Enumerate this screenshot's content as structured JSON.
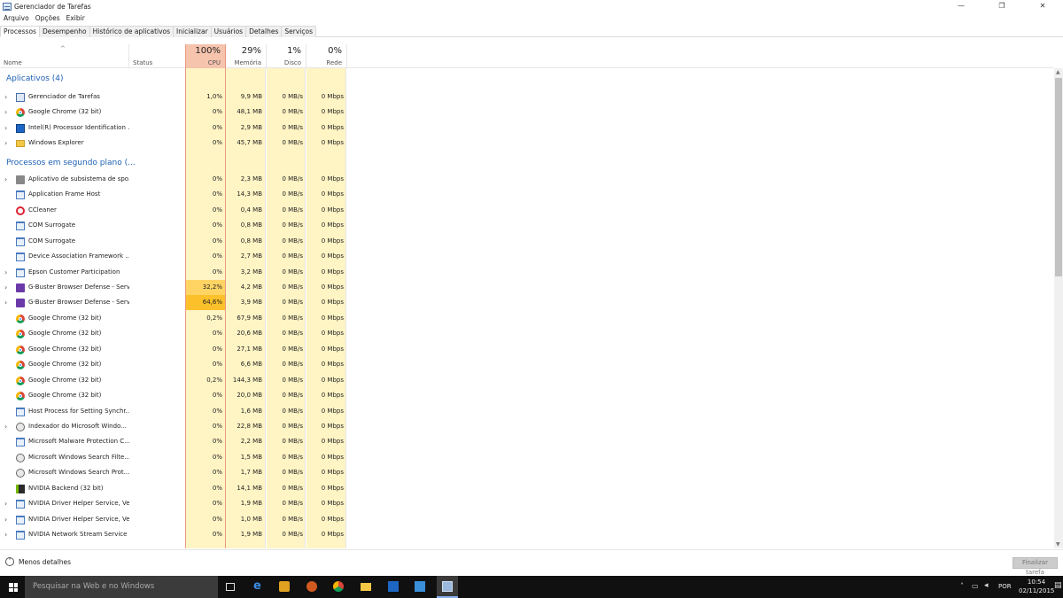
{
  "window": {
    "title": "Gerenciador de Tarefas",
    "minimize": "—",
    "restore": "❐",
    "close": "✕"
  },
  "menu": [
    "Arquivo",
    "Opções",
    "Exibir"
  ],
  "tabs": [
    "Processos",
    "Desempenho",
    "Histórico de aplicativos",
    "Inicializar",
    "Usuários",
    "Detalhes",
    "Serviços"
  ],
  "columns": {
    "name": "Nome",
    "status": "Status",
    "cpu": {
      "pct": "100%",
      "label": "CPU"
    },
    "mem": {
      "pct": "29%",
      "label": "Memória"
    },
    "disk": {
      "pct": "1%",
      "label": "Disco"
    },
    "net": {
      "pct": "0%",
      "label": "Rede"
    }
  },
  "groups": {
    "apps": "Aplicativos (4)",
    "background": "Processos em segundo plano (..."
  },
  "apps": [
    {
      "name": "Gerenciador de Tarefas",
      "cpu": "1,0%",
      "mem": "9,9 MB",
      "disk": "0 MB/s",
      "net": "0 Mbps",
      "icon": "taskmgr-icon",
      "expand": true
    },
    {
      "name": "Google Chrome (32 bit)",
      "cpu": "0%",
      "mem": "48,1 MB",
      "disk": "0 MB/s",
      "net": "0 Mbps",
      "icon": "chrome-icon",
      "expand": true
    },
    {
      "name": "Intel(R) Processor Identification ...",
      "cpu": "0%",
      "mem": "2,9 MB",
      "disk": "0 MB/s",
      "net": "0 Mbps",
      "icon": "intel-icon",
      "expand": true
    },
    {
      "name": "Windows Explorer",
      "cpu": "0%",
      "mem": "45,7 MB",
      "disk": "0 MB/s",
      "net": "0 Mbps",
      "icon": "explorer-icon",
      "expand": true
    }
  ],
  "background": [
    {
      "name": "Aplicativo de subsistema de spo...",
      "cpu": "0%",
      "mem": "2,3 MB",
      "disk": "0 MB/s",
      "net": "0 Mbps",
      "icon": "printer-icon",
      "expand": true
    },
    {
      "name": "Application Frame Host",
      "cpu": "0%",
      "mem": "14,3 MB",
      "disk": "0 MB/s",
      "net": "0 Mbps",
      "icon": "window-icon",
      "expand": false
    },
    {
      "name": "CCleaner",
      "cpu": "0%",
      "mem": "0,4 MB",
      "disk": "0 MB/s",
      "net": "0 Mbps",
      "icon": "ccleaner-icon",
      "expand": false
    },
    {
      "name": "COM Surrogate",
      "cpu": "0%",
      "mem": "0,8 MB",
      "disk": "0 MB/s",
      "net": "0 Mbps",
      "icon": "window-icon",
      "expand": false
    },
    {
      "name": "COM Surrogate",
      "cpu": "0%",
      "mem": "0,8 MB",
      "disk": "0 MB/s",
      "net": "0 Mbps",
      "icon": "window-icon",
      "expand": false
    },
    {
      "name": "Device Association Framework ...",
      "cpu": "0%",
      "mem": "2,7 MB",
      "disk": "0 MB/s",
      "net": "0 Mbps",
      "icon": "window-icon",
      "expand": false
    },
    {
      "name": "Epson Customer Participation",
      "cpu": "0%",
      "mem": "3,2 MB",
      "disk": "0 MB/s",
      "net": "0 Mbps",
      "icon": "window-icon",
      "expand": true
    },
    {
      "name": "G-Buster Browser Defense - Serv...",
      "cpu": "32,2%",
      "mem": "4,2 MB",
      "disk": "0 MB/s",
      "net": "0 Mbps",
      "icon": "gbuster-icon",
      "expand": true,
      "cpuLevel": 0.322
    },
    {
      "name": "G-Buster Browser Defense - Serv...",
      "cpu": "64,6%",
      "mem": "3,9 MB",
      "disk": "0 MB/s",
      "net": "0 Mbps",
      "icon": "gbuster-icon",
      "expand": true,
      "cpuLevel": 0.646
    },
    {
      "name": "Google Chrome (32 bit)",
      "cpu": "0,2%",
      "mem": "67,9 MB",
      "disk": "0 MB/s",
      "net": "0 Mbps",
      "icon": "chrome-icon",
      "expand": false
    },
    {
      "name": "Google Chrome (32 bit)",
      "cpu": "0%",
      "mem": "20,6 MB",
      "disk": "0 MB/s",
      "net": "0 Mbps",
      "icon": "chrome-icon",
      "expand": false
    },
    {
      "name": "Google Chrome (32 bit)",
      "cpu": "0%",
      "mem": "27,1 MB",
      "disk": "0 MB/s",
      "net": "0 Mbps",
      "icon": "chrome-icon",
      "expand": false
    },
    {
      "name": "Google Chrome (32 bit)",
      "cpu": "0%",
      "mem": "6,6 MB",
      "disk": "0 MB/s",
      "net": "0 Mbps",
      "icon": "chrome-icon",
      "expand": false
    },
    {
      "name": "Google Chrome (32 bit)",
      "cpu": "0,2%",
      "mem": "144,3 MB",
      "disk": "0 MB/s",
      "net": "0 Mbps",
      "icon": "chrome-icon",
      "expand": false
    },
    {
      "name": "Google Chrome (32 bit)",
      "cpu": "0%",
      "mem": "20,0 MB",
      "disk": "0 MB/s",
      "net": "0 Mbps",
      "icon": "chrome-icon",
      "expand": false
    },
    {
      "name": "Host Process for Setting Synchr...",
      "cpu": "0%",
      "mem": "1,6 MB",
      "disk": "0 MB/s",
      "net": "0 Mbps",
      "icon": "window-icon",
      "expand": false
    },
    {
      "name": "Indexador do Microsoft Windo...",
      "cpu": "0%",
      "mem": "22,8 MB",
      "disk": "0 MB/s",
      "net": "0 Mbps",
      "icon": "search-indexer-icon",
      "expand": true
    },
    {
      "name": "Microsoft Malware Protection C...",
      "cpu": "0%",
      "mem": "2,2 MB",
      "disk": "0 MB/s",
      "net": "0 Mbps",
      "icon": "window-icon",
      "expand": false
    },
    {
      "name": "Microsoft Windows Search Filte...",
      "cpu": "0%",
      "mem": "1,5 MB",
      "disk": "0 MB/s",
      "net": "0 Mbps",
      "icon": "search-indexer-icon",
      "expand": false
    },
    {
      "name": "Microsoft Windows Search Prot...",
      "cpu": "0%",
      "mem": "1,7 MB",
      "disk": "0 MB/s",
      "net": "0 Mbps",
      "icon": "search-indexer-icon",
      "expand": false
    },
    {
      "name": "NVIDIA Backend (32 bit)",
      "cpu": "0%",
      "mem": "14,1 MB",
      "disk": "0 MB/s",
      "net": "0 Mbps",
      "icon": "nvidia-icon",
      "expand": false
    },
    {
      "name": "NVIDIA Driver Helper Service, Ve...",
      "cpu": "0%",
      "mem": "1,9 MB",
      "disk": "0 MB/s",
      "net": "0 Mbps",
      "icon": "window-icon",
      "expand": true
    },
    {
      "name": "NVIDIA Driver Helper Service, Ve...",
      "cpu": "0%",
      "mem": "1,0 MB",
      "disk": "0 MB/s",
      "net": "0 Mbps",
      "icon": "window-icon",
      "expand": true
    },
    {
      "name": "NVIDIA Network Stream Service",
      "cpu": "0%",
      "mem": "1,9 MB",
      "disk": "0 MB/s",
      "net": "0 Mbps",
      "icon": "window-icon",
      "expand": true
    }
  ],
  "footer": {
    "less": "Menos detalhes",
    "endtask": "Finalizar tarefa"
  },
  "taskbar": {
    "search": "Pesquisar na Web e no Windows",
    "lang": "POR",
    "time": "10:54",
    "date": "02/11/2015"
  },
  "colors": {
    "group": "#1c5fb4",
    "colbg": "#fff4c4",
    "cpuhigh": "#fcc02a",
    "cpumid": "#ffd463"
  }
}
